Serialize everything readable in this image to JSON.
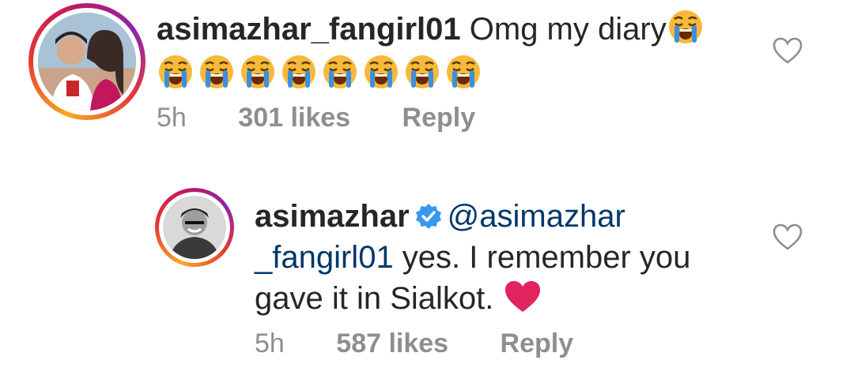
{
  "comment1": {
    "username": "asimazhar_fangirl01",
    "text": "Omg my diary",
    "emoji_name": "crying-face-emoji",
    "emoji_count_line2": 8,
    "time": "5h",
    "likes": "301 likes",
    "reply": "Reply"
  },
  "comment2": {
    "username": "asimazhar",
    "verified_icon": "verified-badge-icon",
    "mention_line1": "@asimazhar",
    "mention_line2": "_fangirl01",
    "text_line2": " yes. I remember you",
    "text_line3": "gave it in Sialkot.",
    "emoji_name": "red-heart-emoji",
    "time": "5h",
    "likes": "587 likes",
    "reply": "Reply"
  },
  "colors": {
    "text": "#262626",
    "meta": "#8e8e8e",
    "mention": "#00376b",
    "verified": "#3897f0",
    "heart_emoji": "#e0245e"
  }
}
